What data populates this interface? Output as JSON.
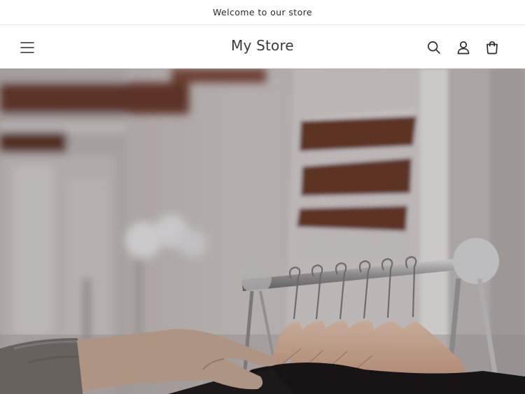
{
  "announcement": {
    "text": "Welcome to our store"
  },
  "header": {
    "logo_text": "My Store",
    "icons": {
      "menu": "hamburger-menu-icon",
      "search": "search-icon",
      "account": "account-icon",
      "cart": "cart-icon"
    }
  },
  "hero": {
    "image_subject": "clothing-rack-with-hangers",
    "overlay_color": "#000000"
  },
  "colors": {
    "background": "#ffffff",
    "text": "#121212",
    "border": "#e8e8e8"
  }
}
